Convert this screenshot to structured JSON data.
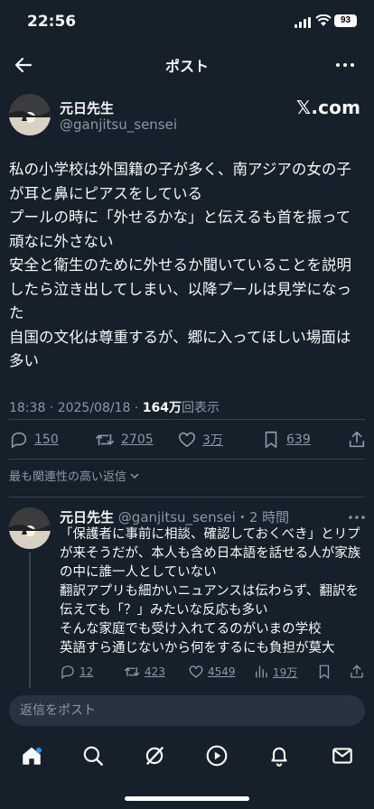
{
  "status": {
    "time": "22:56",
    "battery": "93"
  },
  "header": {
    "title": "ポスト"
  },
  "post": {
    "author_name": "元日先生",
    "author_handle": "@ganjitsu_sensei",
    "source": "𝕏.com",
    "text": "私の小学校は外国籍の子が多く、南アジアの女の子が耳と鼻にピアスをしている\nプールの時に「外せるかな」と伝えるも首を振って頑なに外さない\n安全と衛生のために外せるか聞いていることを説明したら泣き出してしまい、以降プールは見学になった\n自国の文化は尊重するが、郷に入ってほしい場面は多い",
    "time": "18:38 · 2025/08/18 · ",
    "views_count": "164万",
    "views_label": "回表示"
  },
  "actions": {
    "replies": "150",
    "reposts": "2705",
    "likes": "3万",
    "bookmarks": "639"
  },
  "sort_label": "最も関連性の高い返信",
  "reply": {
    "author_name": "元日先生",
    "author_handle": "@ganjitsu_sensei",
    "time": "・2 時間",
    "text": "「保護者に事前に相談、確認しておくべき」とリプが来そうだが、本人も含め日本語を話せる人が家族の中に誰一人としていない\n翻訳アプリも細かいニュアンスは伝わらず、翻訳を伝えても「？」みたいな反応も多い\nそんな家庭でも受け入れてるのがいまの学校\n英語すら通じないから何をするにも負担が莫大",
    "replies": "12",
    "reposts": "423",
    "likes": "4549",
    "views": "19万"
  },
  "composer": {
    "placeholder": "返信をポスト"
  },
  "colors": {
    "background": "#15202b",
    "accent": "#1d9bf0",
    "muted": "#8b98a5",
    "divider": "#38444d"
  },
  "icons": [
    "back-arrow-icon",
    "more-icon",
    "reply-icon",
    "repost-icon",
    "like-icon",
    "bookmark-icon",
    "share-icon",
    "views-icon",
    "home-icon",
    "search-icon",
    "grok-icon",
    "video-icon",
    "notifications-icon",
    "messages-icon"
  ]
}
